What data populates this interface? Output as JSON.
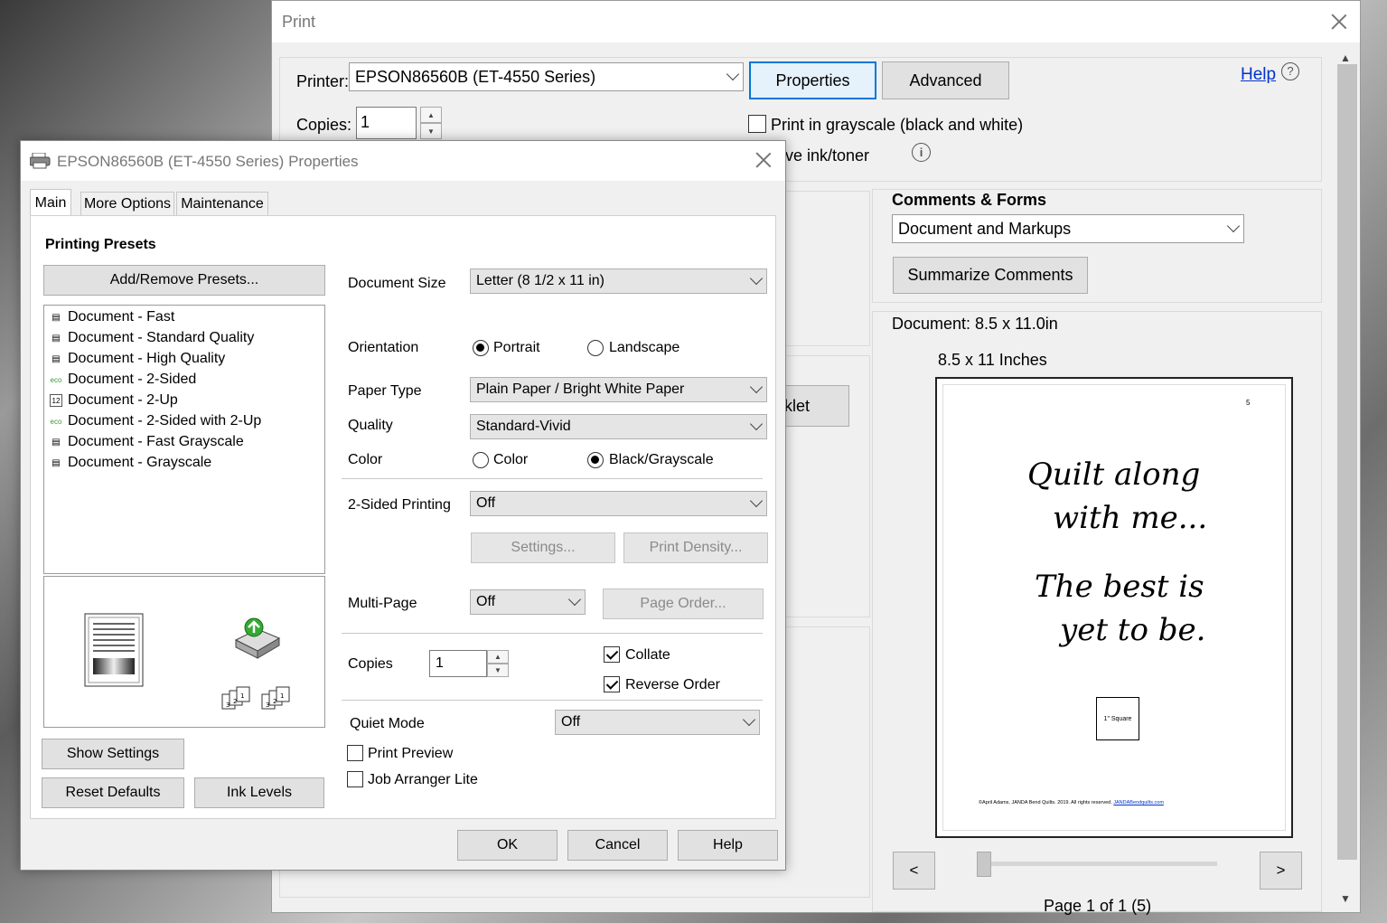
{
  "print_window": {
    "title": "Print",
    "printer_label": "Printer:",
    "printer_value": "EPSON86560B (ET-4550 Series)",
    "properties_button": "Properties",
    "advanced_button": "Advanced",
    "help_link": "Help",
    "copies_label": "Copies:",
    "copies_value": "1",
    "grayscale_label": "Print in grayscale (black and white)",
    "save_ink_label": "ve ink/toner",
    "comments_forms_title": "Comments & Forms",
    "comments_forms_value": "Document and Markups",
    "summarize_button": "Summarize Comments",
    "document_size": "Document: 8.5 x 11.0in",
    "page_size_label": "8.5 x 11 Inches",
    "booklet_partial": "klet",
    "prev_button": "<",
    "next_button": ">",
    "page_indicator": "Page 1 of 1 (5)"
  },
  "preview": {
    "page_number": "5",
    "line1": "Quilt along",
    "line2": "with me...",
    "line3": "The best is",
    "line4": "yet to be.",
    "square_label": "1\" Square",
    "footer_text": "©April Adams, JANDA Bend Quilts. 2019. All rights reserved. ",
    "footer_link": "JANDABendquilts.com"
  },
  "props_dialog": {
    "title": "EPSON86560B (ET-4550 Series) Properties",
    "tabs": [
      "Main",
      "More Options",
      "Maintenance"
    ],
    "printing_presets_title": "Printing Presets",
    "add_remove_presets": "Add/Remove Presets...",
    "presets": [
      "Document - Fast",
      "Document - Standard Quality",
      "Document - High Quality",
      "Document - 2-Sided",
      "Document - 2-Up",
      "Document - 2-Sided with 2-Up",
      "Document - Fast Grayscale",
      "Document - Grayscale"
    ],
    "show_settings": "Show Settings",
    "reset_defaults": "Reset Defaults",
    "ink_levels": "Ink Levels",
    "document_size_label": "Document Size",
    "document_size_value": "Letter (8 1/2 x 11 in)",
    "orientation_label": "Orientation",
    "portrait": "Portrait",
    "landscape": "Landscape",
    "paper_type_label": "Paper Type",
    "paper_type_value": "Plain Paper / Bright White Paper",
    "quality_label": "Quality",
    "quality_value": "Standard-Vivid",
    "color_label": "Color",
    "color_option": "Color",
    "black_grayscale_option": "Black/Grayscale",
    "two_sided_label": "2-Sided Printing",
    "two_sided_value": "Off",
    "settings_button": "Settings...",
    "print_density_button": "Print Density...",
    "multi_page_label": "Multi-Page",
    "multi_page_value": "Off",
    "page_order_button": "Page Order...",
    "copies_label": "Copies",
    "copies_value": "1",
    "collate_label": "Collate",
    "reverse_order_label": "Reverse Order",
    "quiet_mode_label": "Quiet Mode",
    "quiet_mode_value": "Off",
    "print_preview_label": "Print Preview",
    "job_arranger_label": "Job Arranger Lite",
    "ok_button": "OK",
    "cancel_button": "Cancel",
    "help_button": "Help"
  }
}
